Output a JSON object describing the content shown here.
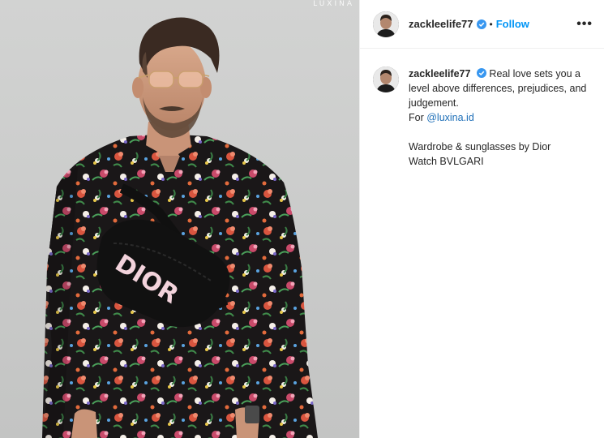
{
  "photo": {
    "watermark": "LUXINA",
    "bag_text": "DIOR"
  },
  "post": {
    "username": "zackleelife77",
    "verified_icon": "verified-badge-icon",
    "separator": "•",
    "follow_label": "Follow",
    "more_label": "•••"
  },
  "caption": {
    "username": "zackleelife77",
    "line1": "Real love sets you a level above differences, prejudices, and judgement.",
    "for_prefix": "For ",
    "mention": "@luxina.id",
    "para2_line1": "Wardrobe & sunglasses by Dior",
    "para2_line2": "Watch BVLGARI"
  },
  "colors": {
    "follow": "#0095f6",
    "verified": "#3897f0",
    "mention": "#1e6fb8"
  }
}
